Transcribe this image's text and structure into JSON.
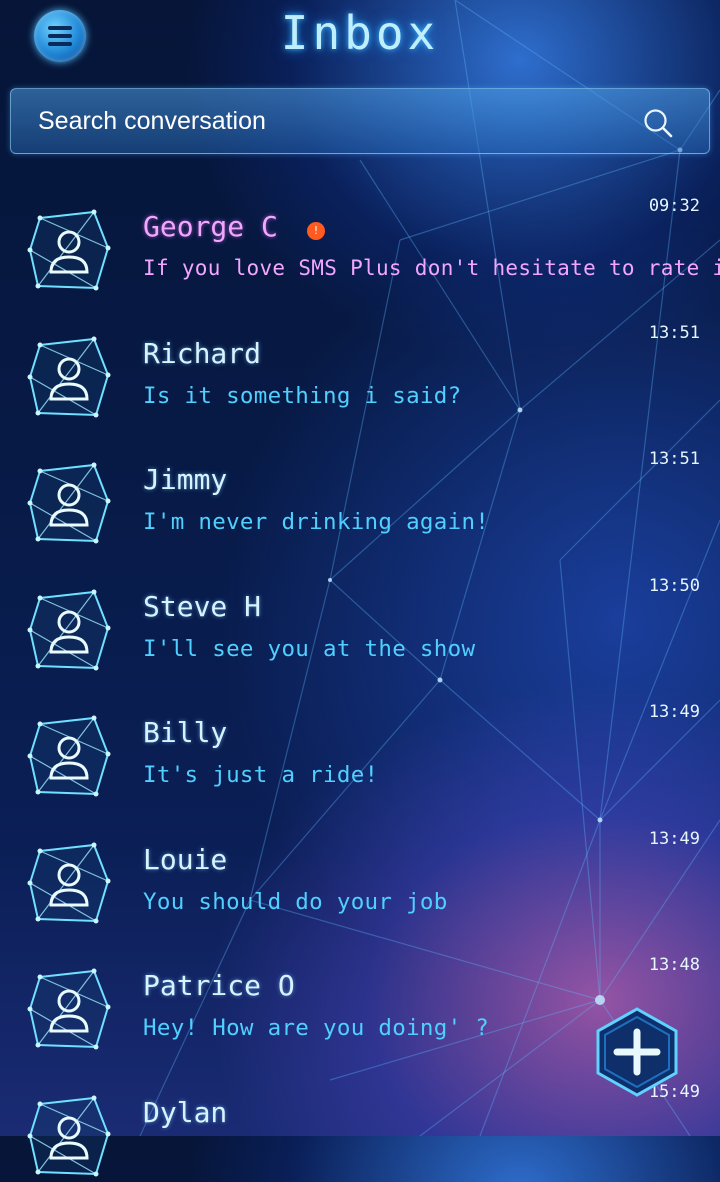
{
  "header": {
    "title": "Inbox",
    "menu_icon": "menu-icon"
  },
  "search": {
    "placeholder": "Search conversation",
    "icon": "search-icon"
  },
  "conversations": [
    {
      "name": "George C",
      "preview": "If you love SMS Plus don't hesitate to rate it!",
      "time": "09:32",
      "unread": true,
      "badge": "!"
    },
    {
      "name": "Richard",
      "preview": "Is it something i said?",
      "time": "13:51",
      "unread": false
    },
    {
      "name": "Jimmy",
      "preview": "I'm never drinking again!",
      "time": "13:51",
      "unread": false
    },
    {
      "name": "Steve H",
      "preview": "I'll see you at the show",
      "time": "13:50",
      "unread": false
    },
    {
      "name": "Billy",
      "preview": "It's just a ride!",
      "time": "13:49",
      "unread": false
    },
    {
      "name": "Louie",
      "preview": "You should do your job",
      "time": "13:49",
      "unread": false
    },
    {
      "name": "Patrice O",
      "preview": "Hey! How are you doing' ?",
      "time": "13:48",
      "unread": false
    },
    {
      "name": "Dylan",
      "preview": "",
      "time": "15:49",
      "unread": false
    }
  ],
  "fab": {
    "icon": "plus-icon"
  },
  "colors": {
    "accent": "#4fd0ff",
    "unread": "#f2a6ff",
    "badge": "#ff5a1f",
    "background": "#071a46"
  }
}
